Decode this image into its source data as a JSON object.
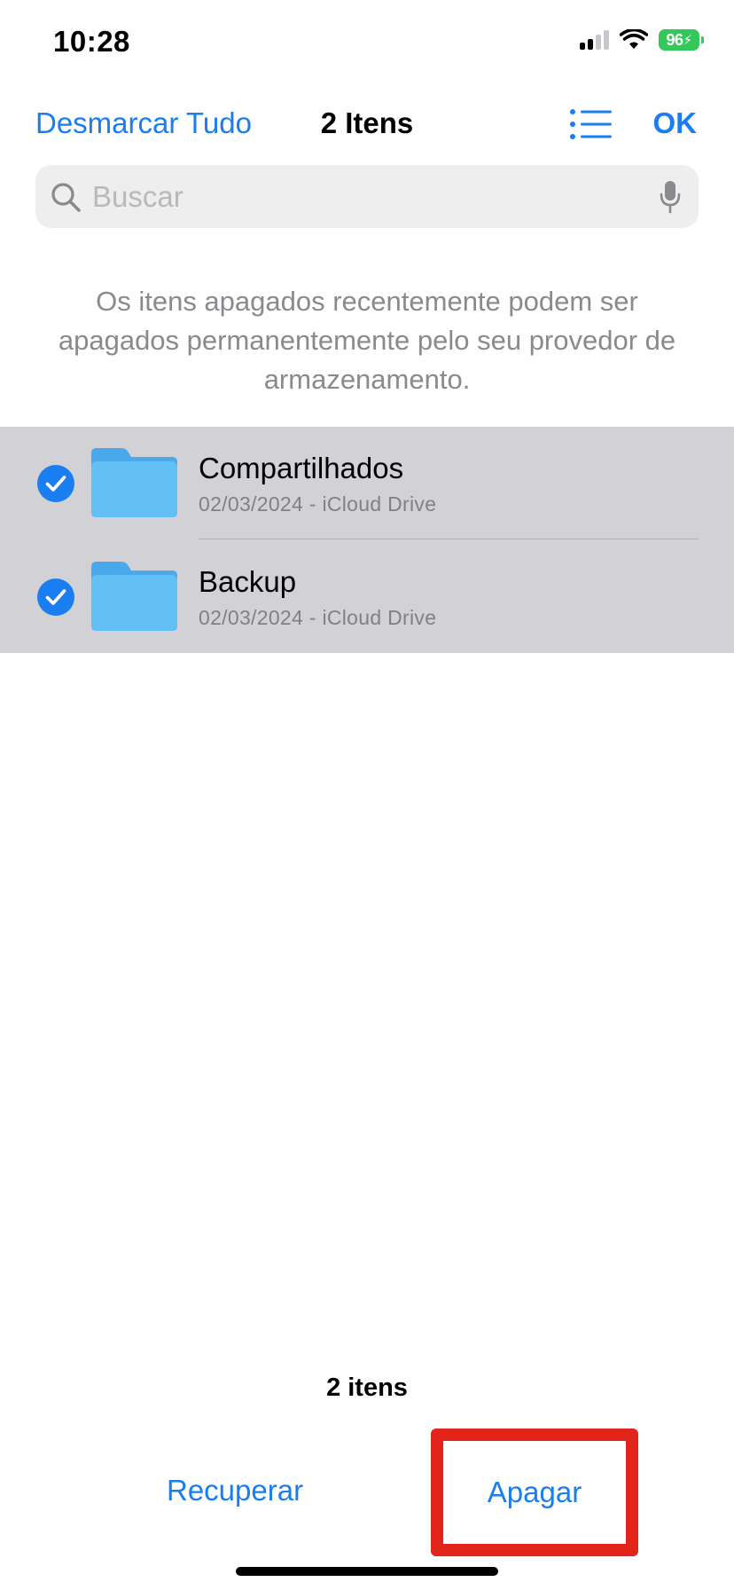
{
  "status_bar": {
    "time": "10:28",
    "battery": "96"
  },
  "nav": {
    "left_action": "Desmarcar Tudo",
    "title": "2 Itens",
    "list_view_icon": "list-icon",
    "right_action": "OK"
  },
  "search": {
    "placeholder": "Buscar",
    "value": ""
  },
  "info_text": "Os itens apagados recentemente podem ser apagados permanentemente pelo seu provedor de armazenamento.",
  "items": [
    {
      "name": "Compartilhados",
      "detail": "02/03/2024 - iCloud Drive",
      "selected": true,
      "icon": "folder-icon"
    },
    {
      "name": "Backup",
      "detail": "02/03/2024 - iCloud Drive",
      "selected": true,
      "icon": "folder-icon"
    }
  ],
  "footer": {
    "count": "2 itens",
    "recover_label": "Recuperar",
    "delete_label": "Apagar"
  },
  "colors": {
    "accent": "#1a7ef0",
    "selected_row_bg": "#d1d1d6",
    "highlight": "#e3241b",
    "folder": "#5cb8f2",
    "battery": "#34c759"
  }
}
